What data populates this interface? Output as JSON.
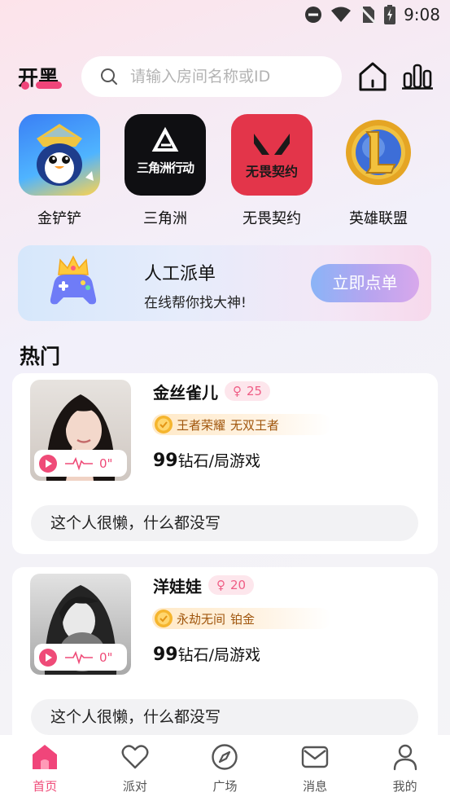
{
  "status_bar": {
    "time": "9:08"
  },
  "header": {
    "logo_text": "开黑",
    "search_placeholder": "请输入房间名称或ID"
  },
  "games": [
    {
      "label": "金铲铲",
      "icon": "penguin-game-icon"
    },
    {
      "label": "三角洲",
      "icon": "delta-force-icon",
      "tile_text": "三角洲行动"
    },
    {
      "label": "无畏契约",
      "icon": "valorant-icon",
      "tile_text": "无畏契约"
    },
    {
      "label": "英雄联盟",
      "icon": "league-icon"
    }
  ],
  "banner": {
    "title": "人工派单",
    "subtitle": "在线帮你找大神!",
    "button": "立即点单"
  },
  "section_title": "热门",
  "players": [
    {
      "name": "金丝雀儿",
      "gender_symbol": "♀",
      "age": "25",
      "game": "王者荣耀",
      "rank": "无双王者",
      "price_amount": "99",
      "price_unit": "钻石/局游戏",
      "voice_duration": "0\"",
      "bio": "这个人很懒，什么都没写"
    },
    {
      "name": "洋娃娃",
      "gender_symbol": "♀",
      "age": "20",
      "game": "永劫无间",
      "rank": "铂金",
      "price_amount": "99",
      "price_unit": "钻石/局游戏",
      "voice_duration": "0\"",
      "bio": "这个人很懒，什么都没写"
    }
  ],
  "nav": [
    {
      "label": "首页",
      "icon": "home-icon",
      "active": true
    },
    {
      "label": "派对",
      "icon": "heart-icon",
      "active": false
    },
    {
      "label": "广场",
      "icon": "compass-icon",
      "active": false
    },
    {
      "label": "消息",
      "icon": "mail-icon",
      "active": false
    },
    {
      "label": "我的",
      "icon": "profile-icon",
      "active": false
    }
  ],
  "colors": {
    "accent": "#ef4b78",
    "background": "#f5f5f7"
  }
}
